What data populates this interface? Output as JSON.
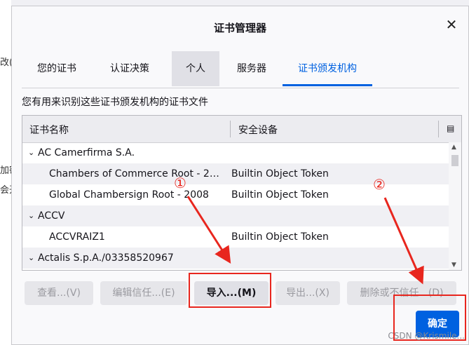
{
  "background": {
    "text_1": "改(C",
    "text_2": "加密",
    "text_3": "会开"
  },
  "dialog": {
    "title": "证书管理器",
    "close_icon": "close-icon"
  },
  "tabs": [
    {
      "label": "您的证书"
    },
    {
      "label": "认证决策"
    },
    {
      "label": "个人"
    },
    {
      "label": "服务器"
    },
    {
      "label": "证书颁发机构"
    }
  ],
  "description": "您有用来识别这些证书颁发机构的证书文件",
  "table": {
    "col_name": "证书名称",
    "col_device": "安全设备",
    "column_picker_icon": "column-picker-icon",
    "rows": [
      {
        "type": "group",
        "name": "AC Camerfirma S.A.",
        "device": ""
      },
      {
        "type": "cert",
        "name": "Chambers of Commerce Root - 2…",
        "device": "Builtin Object Token"
      },
      {
        "type": "cert",
        "name": "Global Chambersign Root - 2008",
        "device": "Builtin Object Token"
      },
      {
        "type": "group",
        "name": "ACCV",
        "device": ""
      },
      {
        "type": "cert",
        "name": "ACCVRAIZ1",
        "device": "Builtin Object Token"
      },
      {
        "type": "group",
        "name": "Actalis S.p.A./03358520967",
        "device": ""
      }
    ]
  },
  "buttons": {
    "view": "查看...(V)",
    "edit_trust": "编辑信任...(E)",
    "import": "导入...(M)",
    "export": "导出...(X)",
    "delete": "删除或不信任...(D)",
    "ok": "确定"
  },
  "annotations": {
    "marker_1": "①",
    "marker_2": "②",
    "color": "#e8261e"
  },
  "watermark": "CSDN @Krismile..."
}
